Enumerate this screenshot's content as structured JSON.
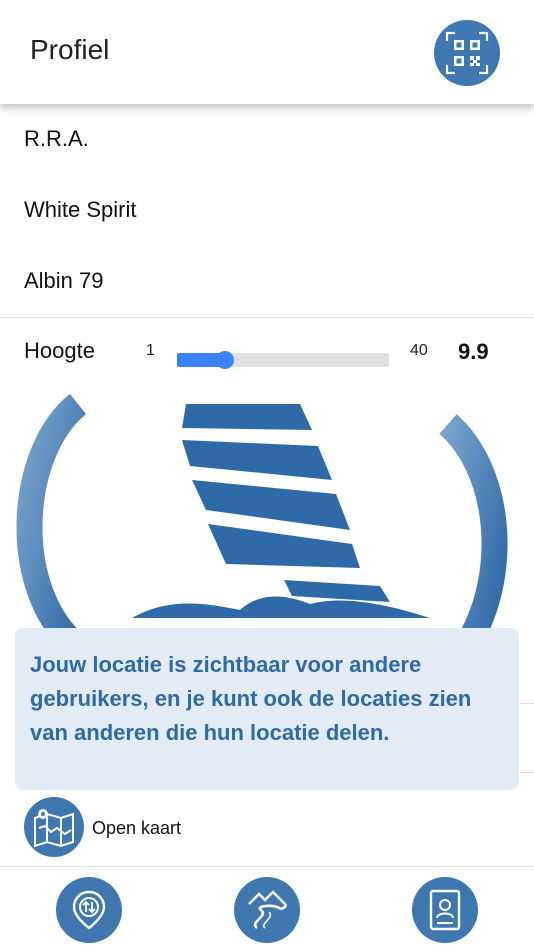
{
  "header": {
    "title": "Profiel",
    "qr_icon": "qr-code-scan-icon"
  },
  "profile": {
    "fields": [
      "R.R.A.",
      "White Spirit",
      "Albin 79"
    ]
  },
  "height_slider": {
    "label": "Hoogte",
    "min_label": "1",
    "max_label": "40",
    "value_display": "9.9",
    "min": 1,
    "max": 40,
    "value": 9.9
  },
  "tooltip": {
    "text": "Jouw locatie is zichtbaar voor andere gebruikers, en je kunt ook de locaties zien van anderen die hun locatie delen."
  },
  "open_map": {
    "label": "Open kaart",
    "icon": "map-icon"
  },
  "bottom_nav": {
    "items": [
      {
        "icon": "location-share-icon"
      },
      {
        "icon": "route-icon"
      },
      {
        "icon": "profile-card-icon"
      }
    ]
  },
  "colors": {
    "accent": "#3f78b0",
    "slider": "#3b82f6",
    "tooltip_bg": "#e3ecf5",
    "tooltip_text": "#2e6aa6"
  }
}
